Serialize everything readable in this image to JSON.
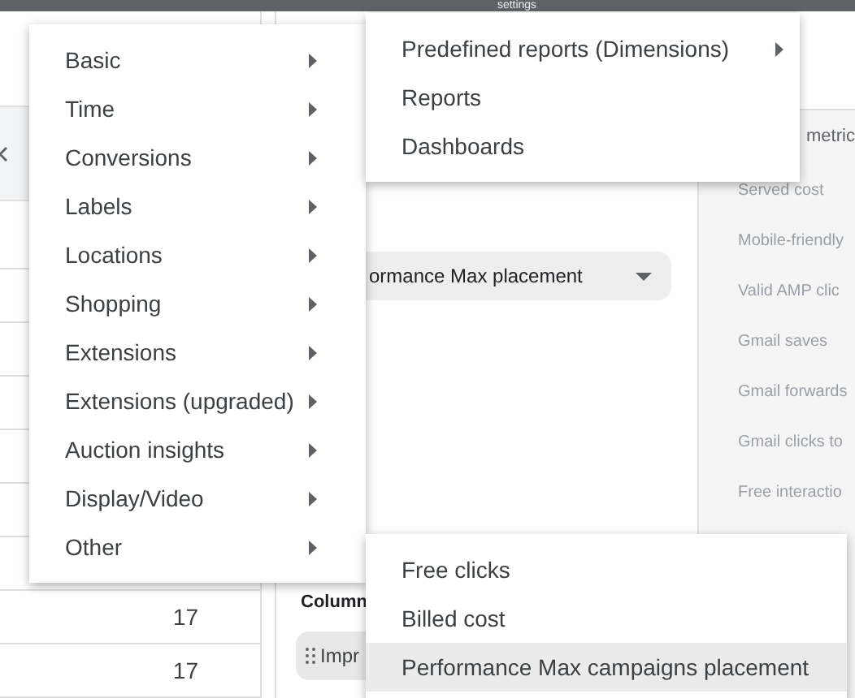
{
  "title_bar": {
    "title": "settings"
  },
  "table": {
    "rows": [
      {
        "value": "17"
      },
      {
        "value": "17"
      }
    ]
  },
  "dimension_select": {
    "value": "ormance Max placement"
  },
  "columns_section": {
    "label": "Column",
    "chip": "Impr"
  },
  "metrics_panel": {
    "header": "metric",
    "items": [
      "Served cost",
      "Mobile-friendly",
      "Valid AMP clic",
      "Gmail saves",
      "Gmail forwards",
      "Gmail clicks to",
      "Free interactio"
    ]
  },
  "menus": [
    {
      "items": [
        {
          "label": "Basic",
          "has_submenu": true
        },
        {
          "label": "Time",
          "has_submenu": true
        },
        {
          "label": "Conversions",
          "has_submenu": true
        },
        {
          "label": "Labels",
          "has_submenu": true
        },
        {
          "label": "Locations",
          "has_submenu": true
        },
        {
          "label": "Shopping",
          "has_submenu": true
        },
        {
          "label": "Extensions",
          "has_submenu": true
        },
        {
          "label": "Extensions (upgraded)",
          "has_submenu": true
        },
        {
          "label": "Auction insights",
          "has_submenu": true
        },
        {
          "label": "Display/Video",
          "has_submenu": true
        },
        {
          "label": "Other",
          "has_submenu": true
        }
      ]
    },
    {
      "items": [
        {
          "label": "Predefined reports (Dimensions)",
          "has_submenu": true
        },
        {
          "label": "Reports",
          "has_submenu": false
        },
        {
          "label": "Dashboards",
          "has_submenu": false
        }
      ]
    },
    {
      "items": [
        {
          "label": "Free clicks",
          "selected": false
        },
        {
          "label": "Billed cost",
          "selected": false
        },
        {
          "label": "Performance Max campaigns placement",
          "selected": true
        }
      ]
    }
  ]
}
